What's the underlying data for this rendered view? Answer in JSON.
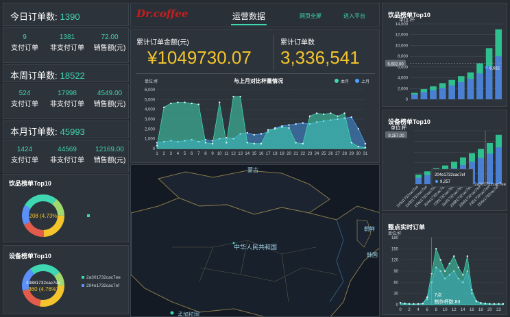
{
  "left": {
    "today": {
      "title": "今日订单数:",
      "count": "1390",
      "vals": [
        "9",
        "1381",
        "72.00"
      ],
      "labels": [
        "支付订单",
        "非支付订单",
        "销售额(元)"
      ]
    },
    "week": {
      "title": "本周订单数:",
      "count": "18522",
      "vals": [
        "524",
        "17998",
        "4549.00"
      ],
      "labels": [
        "支付订单",
        "非支付订单",
        "销售额(元)"
      ]
    },
    "month": {
      "title": "本月订单数:",
      "count": "45993",
      "vals": [
        "1424",
        "44569",
        "12169.00"
      ],
      "labels": [
        "支付订单",
        "非支付订单",
        "销售额(元)"
      ]
    },
    "drink_top10": {
      "title": "饮品榜单Top10",
      "center": "208 (4.73%"
    },
    "device_top10": {
      "title": "设备榜单Top10",
      "center_label": "23881732cac7ee",
      "center_value": "360 (4.76%)",
      "legend": [
        "2a301732cac7ee",
        "204e1732cac7ef"
      ]
    }
  },
  "header": {
    "brand": "Dr.coffee",
    "tabs": [
      "运营数据",
      "网页全屏",
      "进入平台"
    ]
  },
  "totals": {
    "amount_label": "累计订单金额(元)",
    "amount_value": "¥1049730.07",
    "count_label": "累计订单数",
    "count_value": "3,336,541"
  },
  "compare_chart": {
    "title": "与上月对比杯量情况",
    "unit": "单位:杯",
    "legend": [
      "本月",
      "上月"
    ]
  },
  "map": {
    "labels": [
      "蒙古",
      "中华人民共和国",
      "朝鲜",
      "韩国",
      "孟加拉国"
    ]
  },
  "right": {
    "drink_bar": {
      "title": "饮品榜单Top10",
      "unit": "单位:杯",
      "tooltip": "6,682.00",
      "point": "6,682"
    },
    "device_bar": {
      "title": "设备榜单Top10",
      "unit": "单位:杯",
      "tooltip": "9,257.00",
      "tip_name": "204e1732cac7ef",
      "tip_val": "9,257",
      "tip_name2": "2a301732cac7ee"
    },
    "realtime": {
      "title": "整点实时订单",
      "unit": "单位:杯",
      "tooltip_hour": "7点",
      "tooltip_val": "制作杯数:83"
    }
  },
  "chart_data": [
    {
      "type": "area",
      "title": "与上月对比杯量情况",
      "ylabel": "单位:杯",
      "x": [
        1,
        2,
        3,
        4,
        5,
        6,
        7,
        8,
        9,
        10,
        11,
        12,
        13,
        14,
        15,
        16,
        17,
        18,
        19,
        20,
        21,
        22,
        23,
        24,
        25,
        26,
        27,
        28,
        29,
        30,
        31
      ],
      "ylim": [
        0,
        6000
      ],
      "series": [
        {
          "name": "本月",
          "values": [
            300,
            4200,
            4600,
            4700,
            4700,
            4600,
            4500,
            600,
            500,
            4700,
            600,
            5300,
            5300,
            600,
            500,
            500,
            1900,
            2000,
            2200,
            2100,
            600,
            500,
            3300,
            3600,
            3500,
            3600,
            3300,
            3600,
            600,
            200,
            100
          ]
        },
        {
          "name": "上月",
          "values": [
            600,
            700,
            800,
            700,
            800,
            900,
            700,
            900,
            800,
            1000,
            1100,
            1000,
            1500,
            1600,
            1400,
            1500,
            1700,
            2100,
            2300,
            2400,
            2500,
            2600,
            2500,
            2700,
            2800,
            2900,
            3000,
            3100,
            3200,
            2000,
            500
          ]
        }
      ]
    },
    {
      "type": "bar",
      "title": "饮品榜单Top10",
      "ylabel": "单位:杯",
      "ylim": [
        0,
        14000
      ],
      "series": [
        {
          "name": "",
          "values": [
            1200,
            1900,
            2400,
            3000,
            3600,
            4300,
            5000,
            6682,
            9500,
            13000
          ]
        },
        {
          "name": "",
          "values": [
            900,
            1300,
            1700,
            2100,
            2600,
            3200,
            3800,
            4800,
            6200,
            8000
          ]
        }
      ]
    },
    {
      "type": "bar",
      "title": "设备榜单Top10",
      "ylabel": "单位:杯",
      "ylim": [
        0,
        10000
      ],
      "categories": [
        "2e5d1732cac7ee",
        "2a301732cac7ee",
        "24bb1732cac7ee",
        "204e1732cac7ef",
        "2281732cac7ee",
        "2a4f1732cac7ee",
        "23881732cac7ee",
        "23b91732cac7ee",
        "2301732cac7ee",
        "204e1732cac7ef"
      ],
      "series": [
        {
          "name": "",
          "values": [
            1800,
            2400,
            3000,
            3500,
            4200,
            5000,
            5800,
            6600,
            7700,
            9257
          ]
        },
        {
          "name": "",
          "values": [
            1200,
            1700,
            2100,
            2500,
            3000,
            3600,
            4200,
            4900,
            5700,
            6900
          ]
        }
      ]
    },
    {
      "type": "area",
      "title": "整点实时订单",
      "ylabel": "单位:杯",
      "x": [
        0,
        1,
        2,
        3,
        4,
        5,
        6,
        7,
        8,
        9,
        10,
        11,
        12,
        13,
        14,
        15,
        16,
        17,
        18,
        19,
        20,
        21,
        22,
        23
      ],
      "ylim": [
        0,
        180
      ],
      "series": [
        {
          "name": "",
          "values": [
            5,
            3,
            2,
            2,
            2,
            3,
            20,
            83,
            150,
            120,
            90,
            110,
            130,
            100,
            80,
            130,
            40,
            10,
            5,
            3,
            2,
            2,
            2,
            2
          ]
        },
        {
          "name": "",
          "values": [
            5,
            3,
            2,
            2,
            2,
            3,
            15,
            60,
            100,
            90,
            70,
            80,
            90,
            70,
            60,
            90,
            30,
            8,
            4,
            3,
            2,
            2,
            2,
            2
          ]
        }
      ]
    }
  ]
}
